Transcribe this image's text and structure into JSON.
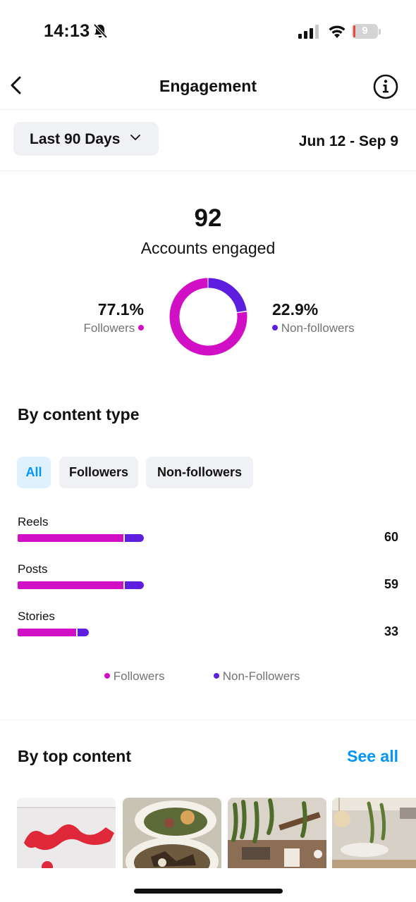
{
  "status_bar": {
    "time": "14:13",
    "battery": "9",
    "battery_level": 0.09
  },
  "header": {
    "title": "Engagement"
  },
  "filter": {
    "range_label": "Last 90 Days",
    "date_range": "Jun 12 - Sep 9"
  },
  "summary": {
    "total": "92",
    "total_label": "Accounts engaged",
    "followers_pct": "77.1%",
    "followers_label": "Followers",
    "nonfollowers_pct": "22.9%",
    "nonfollowers_label": "Non-followers"
  },
  "content_type": {
    "title": "By content type",
    "chips": [
      "All",
      "Followers",
      "Non-followers"
    ],
    "active_chip": "All",
    "rows": [
      {
        "label": "Reels",
        "value": "60"
      },
      {
        "label": "Posts",
        "value": "59"
      },
      {
        "label": "Stories",
        "value": "33"
      }
    ],
    "legend_followers": "Followers",
    "legend_nonfollowers": "Non-Followers"
  },
  "top_content": {
    "title": "By top content",
    "see_all": "See all"
  },
  "colors": {
    "followers": "#d10fc4",
    "nonfollowers": "#5e1ee0",
    "link": "#0095f6"
  },
  "chart_data": {
    "type": "pie",
    "categories": [
      "Followers",
      "Non-followers"
    ],
    "values": [
      77.1,
      22.9
    ],
    "donut": true
  }
}
